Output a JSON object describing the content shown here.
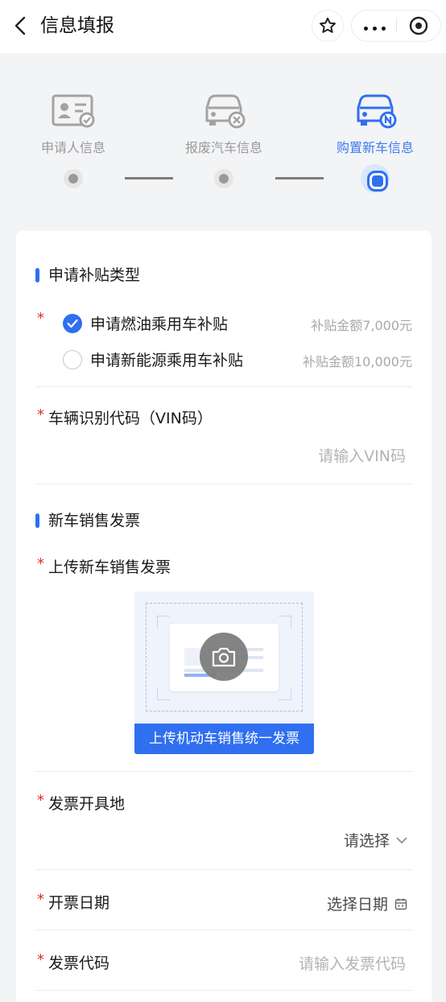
{
  "topbar": {
    "title": "信息填报",
    "back_icon": "back-icon",
    "star_icon": "star-icon",
    "more_icon": "more-icon",
    "close_icon": "close-circle-icon"
  },
  "steps": [
    {
      "label": "申请人信息",
      "state": "done",
      "icon": "id-card-icon"
    },
    {
      "label": "报废汽车信息",
      "state": "done",
      "icon": "car-scrap-icon"
    },
    {
      "label": "购置新车信息",
      "state": "active",
      "icon": "car-new-icon"
    }
  ],
  "subsidy": {
    "title": "申请补贴类型",
    "options": [
      {
        "label": "申请燃油乘用车补贴",
        "amount": "补贴金额7,000元",
        "checked": true
      },
      {
        "label": "申请新能源乘用车补贴",
        "amount": "补贴金额10,000元",
        "checked": false
      }
    ]
  },
  "vin": {
    "label": "车辆识别代码（VIN码）",
    "placeholder": "请输入VIN码"
  },
  "invoice": {
    "title": "新车销售发票",
    "upload_label": "上传新车销售发票",
    "upload_button": "上传机动车销售统一发票"
  },
  "issue_place": {
    "label": "发票开具地",
    "value": "请选择"
  },
  "issue_date": {
    "label": "开票日期",
    "value": "选择日期"
  },
  "invoice_code": {
    "label": "发票代码",
    "placeholder": "请输入发票代码"
  },
  "required_mark": "*",
  "colors": {
    "accent": "#2f6ff0",
    "required": "#e22b2b",
    "placeholder": "#b3b3b3"
  }
}
